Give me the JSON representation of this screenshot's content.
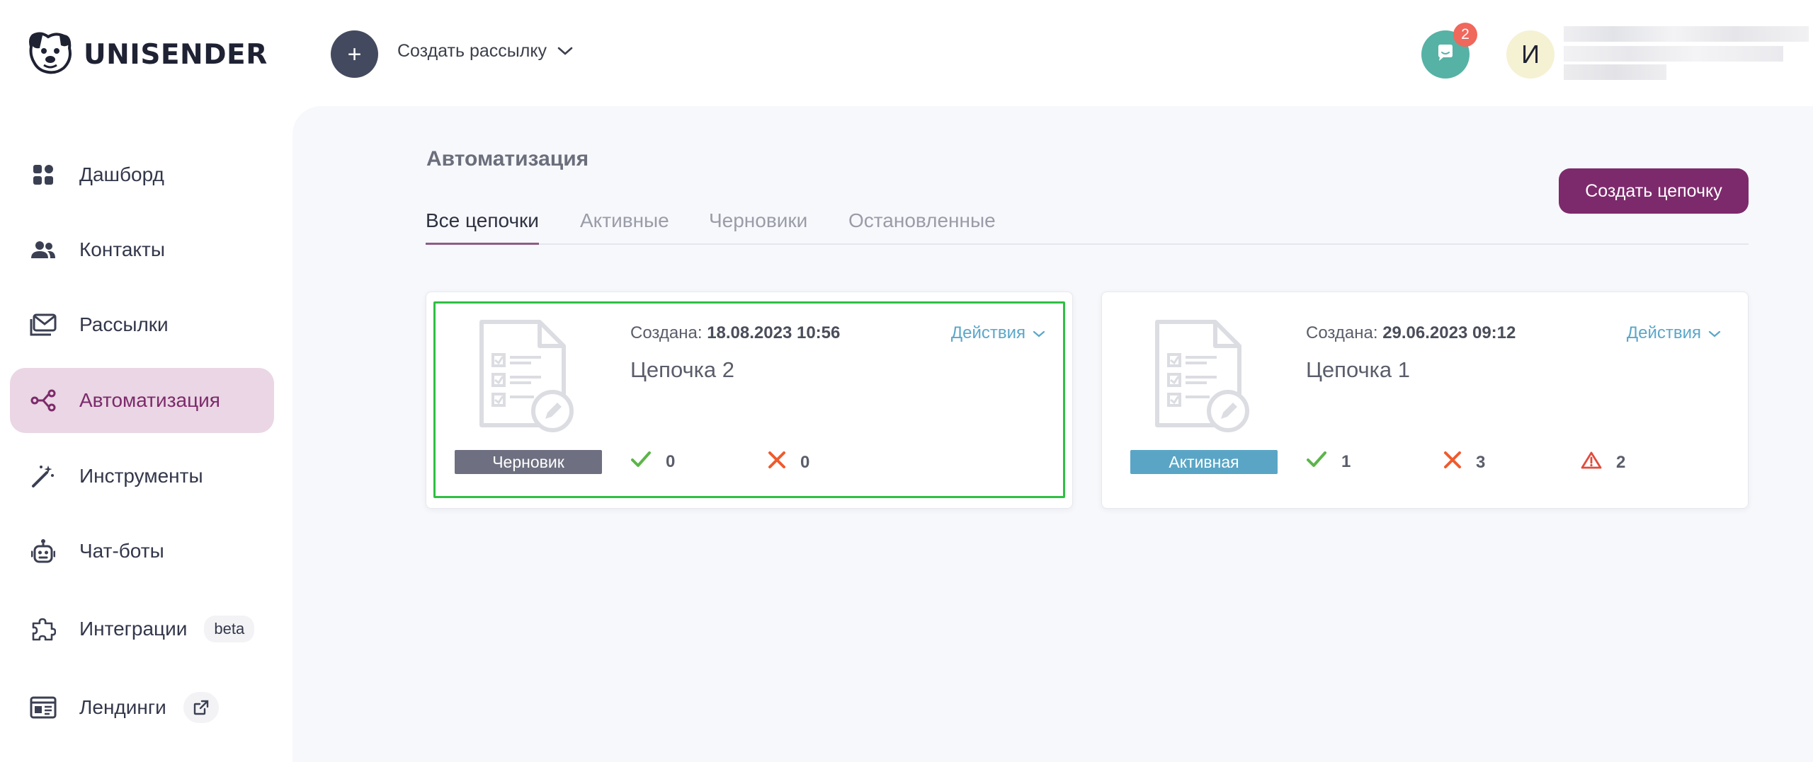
{
  "header": {
    "logo_text": "UNISENDER",
    "create_mailing_label": "Создать рассылку",
    "chat_badge_count": "2",
    "avatar_letter": "И"
  },
  "sidebar": {
    "items": [
      {
        "label": "Дашборд",
        "icon": "dashboard-icon"
      },
      {
        "label": "Контакты",
        "icon": "contacts-icon"
      },
      {
        "label": "Рассылки",
        "icon": "mail-icon"
      },
      {
        "label": "Автоматизация",
        "icon": "automation-icon",
        "active": true
      },
      {
        "label": "Инструменты",
        "icon": "magic-wand-icon"
      },
      {
        "label": "Чат-боты",
        "icon": "robot-icon"
      },
      {
        "label": "Интеграции",
        "icon": "puzzle-icon",
        "badge": "beta"
      },
      {
        "label": "Лендинги",
        "icon": "landing-icon",
        "external_icon": "external-link-icon"
      }
    ]
  },
  "main": {
    "title": "Автоматизация",
    "create_chain_label": "Создать цепочку",
    "tabs": [
      {
        "label": "Все цепочки",
        "active": true
      },
      {
        "label": "Активные"
      },
      {
        "label": "Черновики"
      },
      {
        "label": "Остановленные"
      }
    ],
    "chains": [
      {
        "created_label": "Создана:",
        "created_value": "18.08.2023 10:56",
        "name": "Цепочка 2",
        "actions_label": "Действия",
        "status": "Черновик",
        "success": "0",
        "errors": "0"
      },
      {
        "created_label": "Создана:",
        "created_value": "29.06.2023 09:12",
        "name": "Цепочка 1",
        "actions_label": "Действия",
        "status": "Активная",
        "success": "1",
        "errors": "3",
        "warnings": "2"
      }
    ]
  },
  "colors": {
    "brand": "#7d2a6c",
    "active_nav_bg": "#ead6e4",
    "success": "#5cb54a",
    "error": "#ef5b2e",
    "warning": "#e24b3c",
    "link": "#5ba7c9",
    "highlight": "#2fbf44"
  }
}
